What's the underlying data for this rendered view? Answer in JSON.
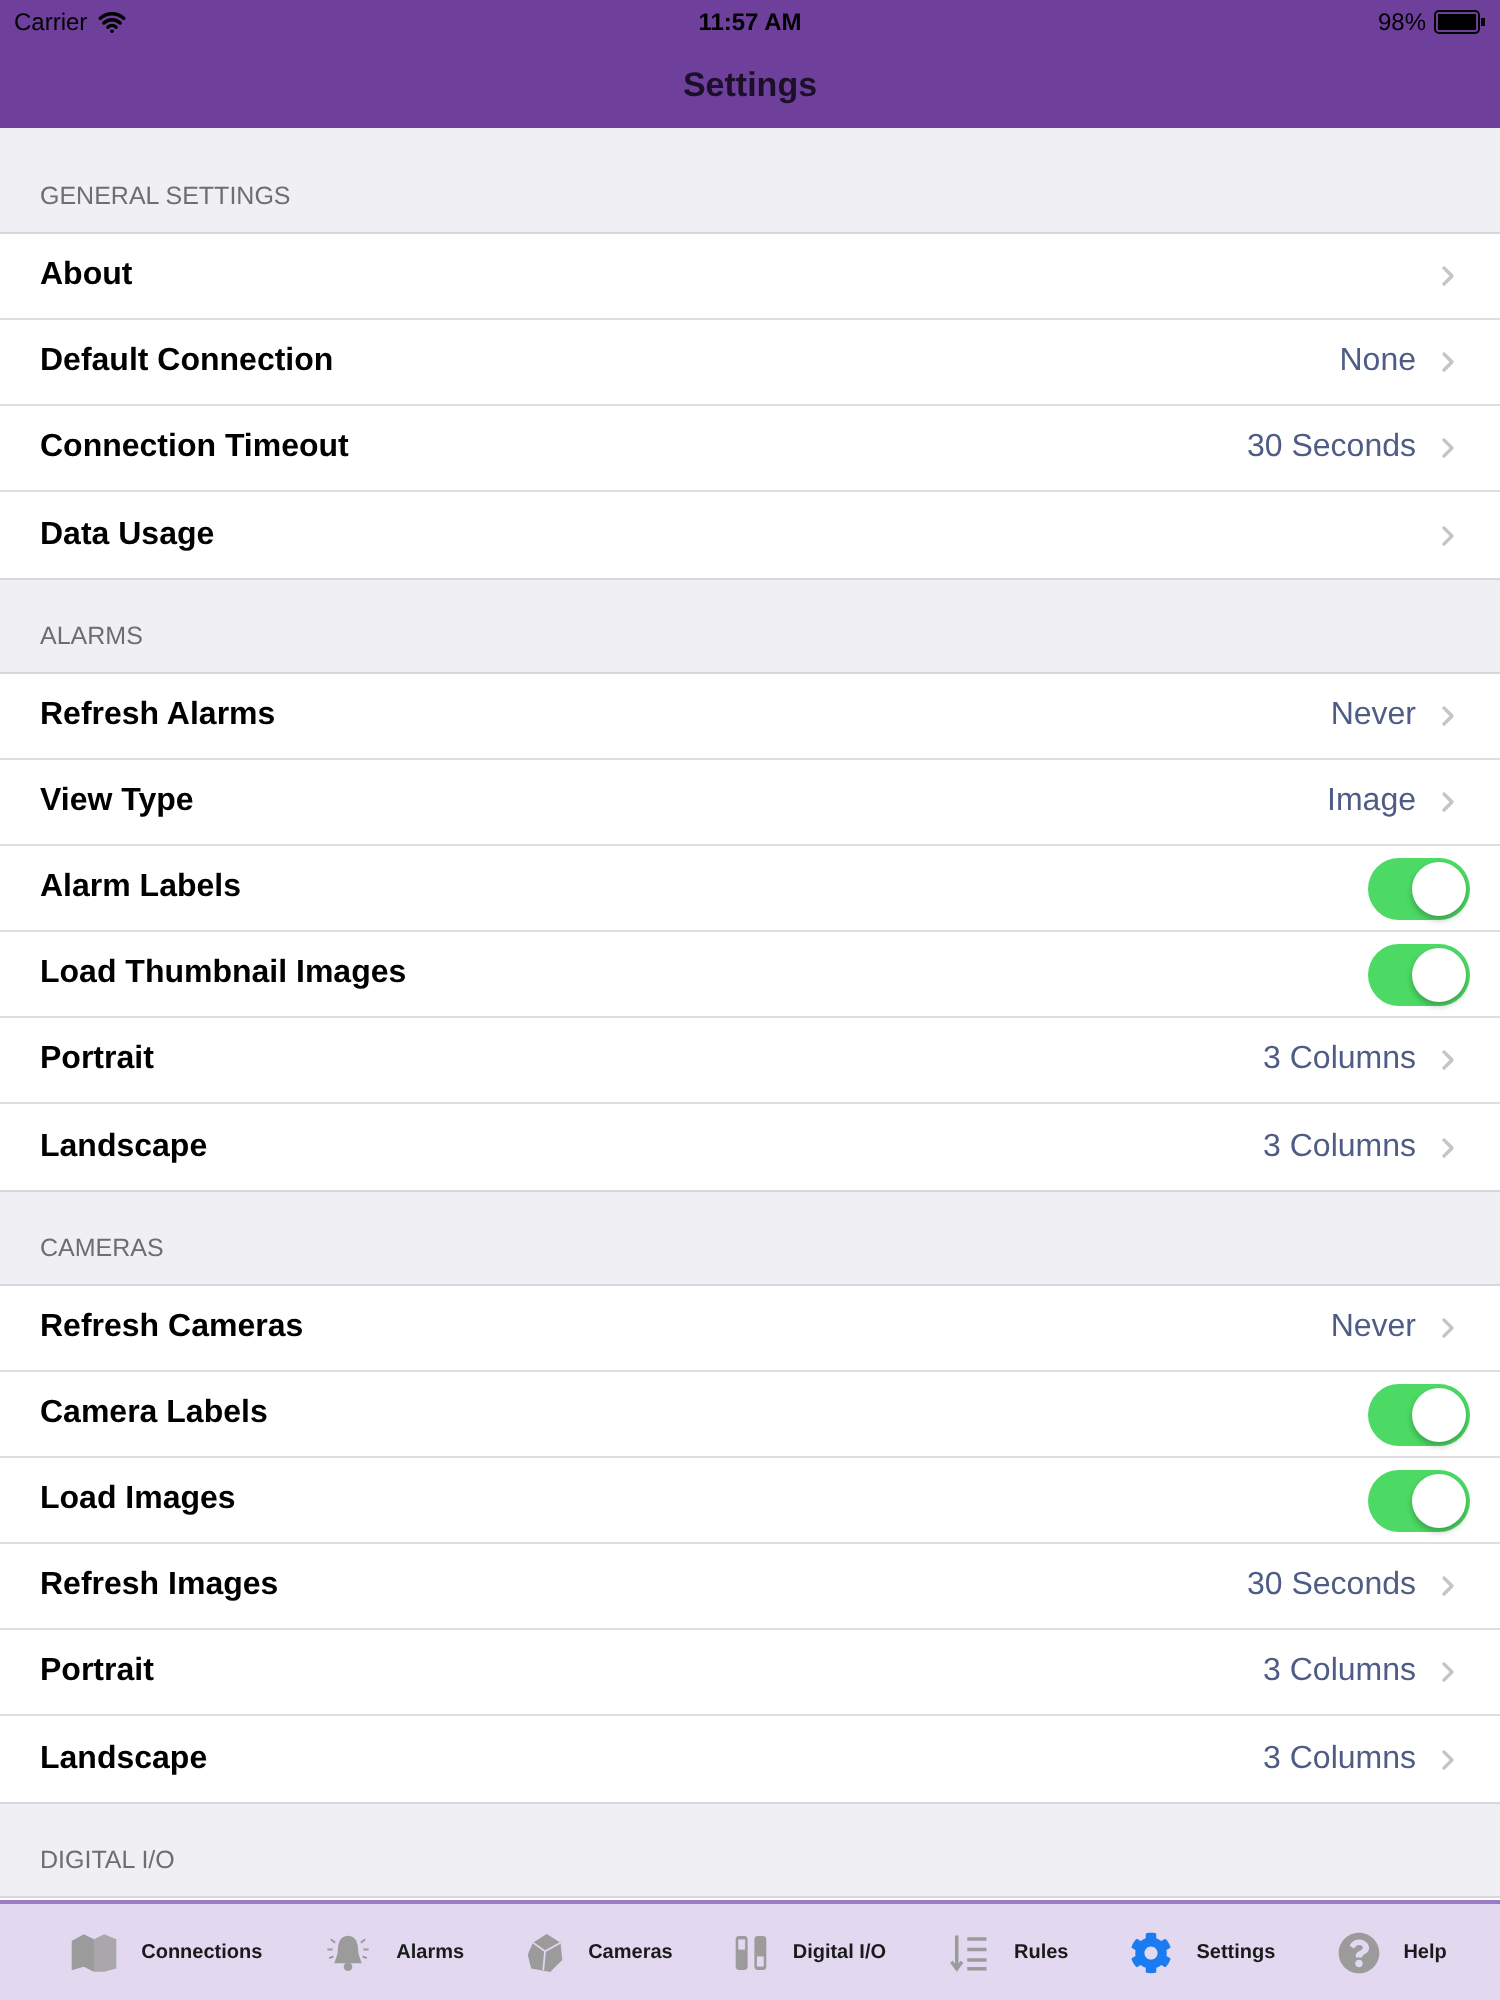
{
  "status_bar": {
    "carrier": "Carrier",
    "time": "11:57 AM",
    "battery": "98%"
  },
  "nav_bar": {
    "title": "Settings"
  },
  "sections": [
    {
      "header": "GENERAL SETTINGS",
      "rows": [
        {
          "kind": "link",
          "label": "About"
        },
        {
          "kind": "link",
          "label": "Default Connection",
          "value": "None"
        },
        {
          "kind": "link",
          "label": "Connection Timeout",
          "value": "30 Seconds"
        },
        {
          "kind": "link",
          "label": "Data Usage"
        }
      ]
    },
    {
      "header": "ALARMS",
      "rows": [
        {
          "kind": "link",
          "label": "Refresh Alarms",
          "value": "Never"
        },
        {
          "kind": "link",
          "label": "View Type",
          "value": "Image"
        },
        {
          "kind": "toggle",
          "label": "Alarm Labels",
          "on": true
        },
        {
          "kind": "toggle",
          "label": "Load Thumbnail Images",
          "on": true
        },
        {
          "kind": "link",
          "label": "Portrait",
          "value": "3 Columns"
        },
        {
          "kind": "link",
          "label": "Landscape",
          "value": "3 Columns"
        }
      ]
    },
    {
      "header": "CAMERAS",
      "rows": [
        {
          "kind": "link",
          "label": "Refresh Cameras",
          "value": "Never"
        },
        {
          "kind": "toggle",
          "label": "Camera Labels",
          "on": true
        },
        {
          "kind": "toggle",
          "label": "Load Images",
          "on": true
        },
        {
          "kind": "link",
          "label": "Refresh Images",
          "value": "30 Seconds"
        },
        {
          "kind": "link",
          "label": "Portrait",
          "value": "3 Columns"
        },
        {
          "kind": "link",
          "label": "Landscape",
          "value": "3 Columns"
        }
      ]
    },
    {
      "header": "DIGITAL I/O"
    }
  ],
  "tab_bar": {
    "items": [
      {
        "label": "Connections",
        "selected": false
      },
      {
        "label": "Alarms",
        "selected": false
      },
      {
        "label": "Cameras",
        "selected": false
      },
      {
        "label": "Digital I/O",
        "selected": false
      },
      {
        "label": "Rules",
        "selected": false
      },
      {
        "label": "Settings",
        "selected": true
      },
      {
        "label": "Help",
        "selected": false
      }
    ]
  }
}
